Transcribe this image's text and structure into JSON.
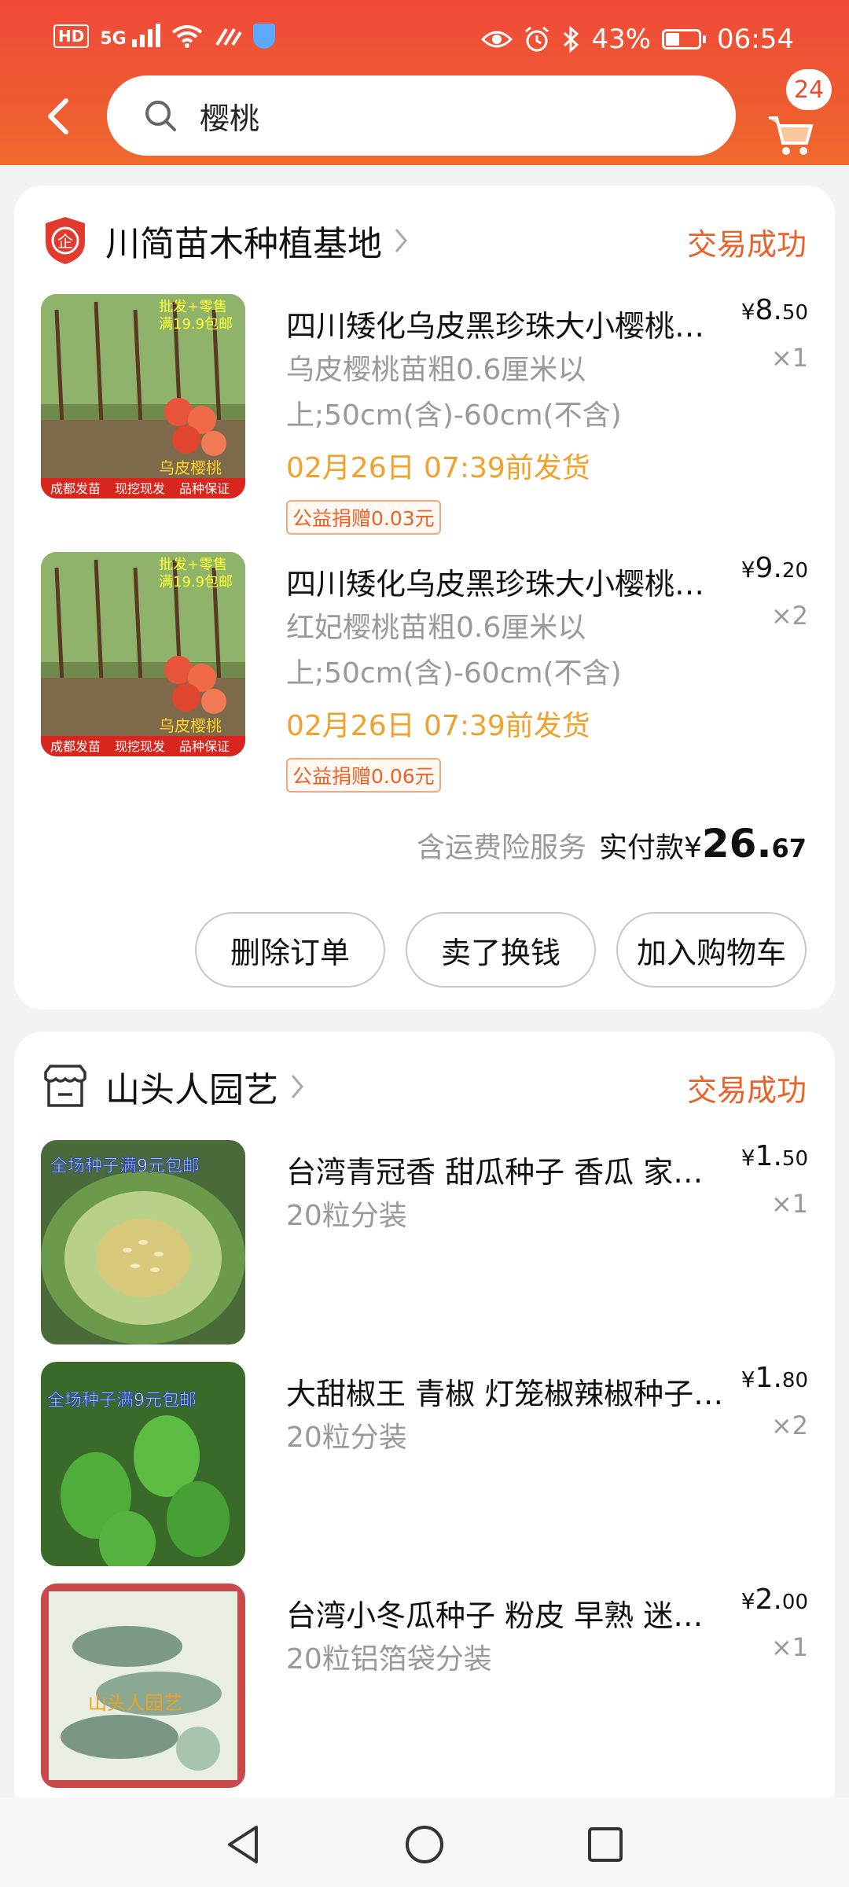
{
  "status_bar": {
    "hd": "HD",
    "signal": "5G",
    "battery": "43%",
    "battery_level": 0.43,
    "time": "06:54"
  },
  "header": {
    "search_text": "樱桃",
    "cart_count": "24"
  },
  "orders": [
    {
      "shop_name": "川简苗木种植基地",
      "status": "交易成功",
      "items": [
        {
          "title": "四川矮化乌皮黑珍珠大小樱桃苗果树苗南方北方种植盆栽地栽当年结果",
          "sku": "乌皮樱桃苗粗0.6厘米以上;50cm(含)-60cm(不含)",
          "ship": "02月26日 07:39前发货",
          "donate": "公益捐赠0.03元",
          "price_cur": "¥",
          "price_int": "8.",
          "price_dec": "50",
          "qty": "×1",
          "image_text": [
            "批发+零售",
            "满19.9包邮",
            "乌皮樱桃",
            "成都发苗",
            "现挖现发",
            "品种保证"
          ]
        },
        {
          "title": "四川矮化乌皮黑珍珠大小樱桃苗果树苗南方北方种植盆栽地栽当年结果",
          "sku": "红妃樱桃苗粗0.6厘米以上;50cm(含)-60cm(不含)",
          "ship": "02月26日 07:39前发货",
          "donate": "公益捐赠0.06元",
          "price_cur": "¥",
          "price_int": "9.",
          "price_dec": "20",
          "qty": "×2",
          "image_text": [
            "批发+零售",
            "满19.9包邮",
            "乌皮樱桃",
            "成都发苗",
            "现挖现发",
            "品种保证"
          ]
        }
      ],
      "total": {
        "note": "含运费险服务",
        "label": "实付款¥",
        "int": "26.",
        "dec": "67"
      },
      "buttons": {
        "delete": "删除订单",
        "sell": "卖了换钱",
        "add_cart": "加入购物车"
      }
    },
    {
      "shop_name": "山头人园艺",
      "status": "交易成功",
      "items": [
        {
          "title": "台湾青冠香 甜瓜种子 香瓜 家庭阳台盆栽四季播种蔬菜种子",
          "sku": "20粒分装",
          "price_cur": "¥",
          "price_int": "1.",
          "price_dec": "50",
          "qty": "×1",
          "image_text": "全场种子满9元包邮"
        },
        {
          "title": "大甜椒王 青椒 灯笼椒辣椒种子 阳台盆栽四季蔬菜种子",
          "sku": "20粒分装",
          "price_cur": "¥",
          "price_int": "1.",
          "price_dec": "80",
          "qty": "×2",
          "image_text": "全场种子满9元包邮"
        },
        {
          "title": "台湾小冬瓜种子 粉皮 早熟 迷你小冬瓜蔬菜种子",
          "sku": "20粒铝箔袋分装",
          "price_cur": "¥",
          "price_int": "2.",
          "price_dec": "00",
          "qty": "×1",
          "image_text": "山头人园艺"
        }
      ]
    }
  ],
  "colors": {
    "header_red": "#f04a3a",
    "accent_orange": "#e8622a",
    "ship_orange": "#f1a12a"
  }
}
